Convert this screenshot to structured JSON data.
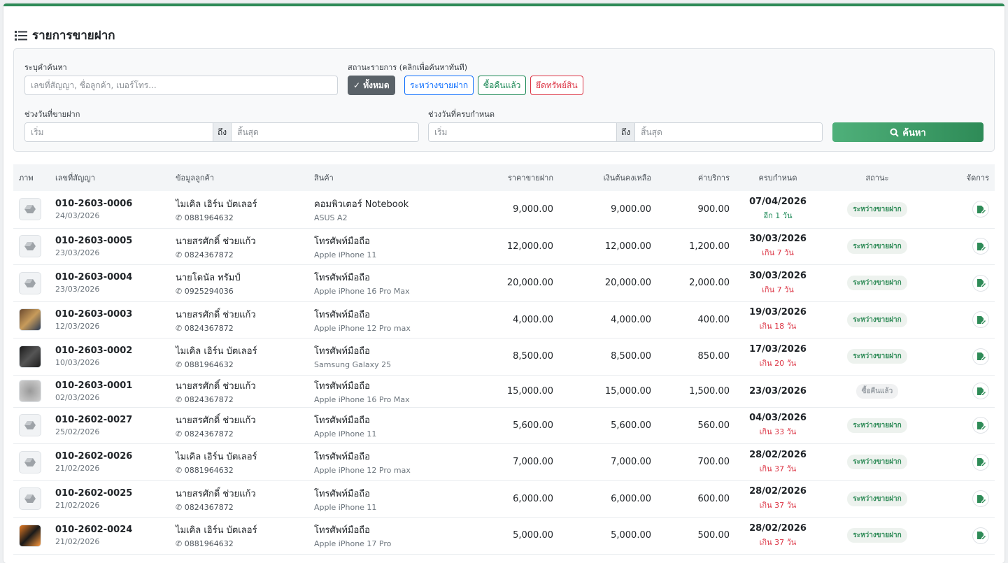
{
  "title": "รายการขายฝาก",
  "filters": {
    "keyword_label": "ระบุคำค้นหา",
    "keyword_placeholder": "เลขที่สัญญา, ชื่อลูกค้า, เบอร์โทร...",
    "status_label": "สถานะรายการ (คลิกเพื่อค้นหาทันที)",
    "status_buttons": [
      "ทั้งหมด",
      "ระหว่างขายฝาก",
      "ซื้อคืนแล้ว",
      "ยึดทรัพย์สิน"
    ],
    "sale_date_label": "ช่วงวันที่ขายฝาก",
    "due_date_label": "ช่วงวันที่ครบกำหนด",
    "start_placeholder": "เริ่ม",
    "to_label": "ถึง",
    "end_placeholder": "สิ้นสุด",
    "search_label": "ค้นหา"
  },
  "table": {
    "headers": [
      "ภาพ",
      "เลขที่สัญญา",
      "ข้อมูลลูกค้า",
      "สินค้า",
      "ราคาขายฝาก",
      "เงินต้นคงเหลือ",
      "ค่าบริการ",
      "ครบกำหนด",
      "สถานะ",
      "จัดการ"
    ],
    "rows": [
      {
        "thumb": "placeholder",
        "contract": "010-2603-0006",
        "date": "24/03/2026",
        "customer": "ไมเคิล เอิร์น บัตเลอร์",
        "phone": "0881964632",
        "product": "คอมพิวเตอร์ Notebook",
        "model": "ASUS A2",
        "price": "9,000.00",
        "principal": "9,000.00",
        "fee": "900.00",
        "due": "07/04/2026",
        "due_note": "อีก 1 วัน",
        "due_state": "ok",
        "status": "ระหว่างขายฝาก",
        "status_state": "pending"
      },
      {
        "thumb": "placeholder",
        "contract": "010-2603-0005",
        "date": "23/03/2026",
        "customer": "นายสรศักดิ์ ช่วยแก้ว",
        "phone": "0824367872",
        "product": "โทรศัพท์มือถือ",
        "model": "Apple iPhone 11",
        "price": "12,000.00",
        "principal": "12,000.00",
        "fee": "1,200.00",
        "due": "30/03/2026",
        "due_note": "เกิน 7 วัน",
        "due_state": "late",
        "status": "ระหว่างขายฝาก",
        "status_state": "pending"
      },
      {
        "thumb": "placeholder",
        "contract": "010-2603-0004",
        "date": "23/03/2026",
        "customer": "นายโดนัล ทรัมป์",
        "phone": "0925294036",
        "product": "โทรศัพท์มือถือ",
        "model": "Apple iPhone 16 Pro Max",
        "price": "20,000.00",
        "principal": "20,000.00",
        "fee": "2,000.00",
        "due": "30/03/2026",
        "due_note": "เกิน 7 วัน",
        "due_state": "late",
        "status": "ระหว่างขายฝาก",
        "status_state": "pending"
      },
      {
        "thumb": "photo1",
        "contract": "010-2603-0003",
        "date": "12/03/2026",
        "customer": "นายสรศักดิ์ ช่วยแก้ว",
        "phone": "0824367872",
        "product": "โทรศัพท์มือถือ",
        "model": "Apple iPhone 12 Pro max",
        "price": "4,000.00",
        "principal": "4,000.00",
        "fee": "400.00",
        "due": "19/03/2026",
        "due_note": "เกิน 18 วัน",
        "due_state": "late",
        "status": "ระหว่างขายฝาก",
        "status_state": "pending"
      },
      {
        "thumb": "photo2",
        "contract": "010-2603-0002",
        "date": "10/03/2026",
        "customer": "ไมเคิล เอิร์น บัตเลอร์",
        "phone": "0881964632",
        "product": "โทรศัพท์มือถือ",
        "model": "Samsung Galaxy 25",
        "price": "8,500.00",
        "principal": "8,500.00",
        "fee": "850.00",
        "due": "17/03/2026",
        "due_note": "เกิน 20 วัน",
        "due_state": "late",
        "status": "ระหว่างขายฝาก",
        "status_state": "pending"
      },
      {
        "thumb": "photo3",
        "contract": "010-2603-0001",
        "date": "02/03/2026",
        "customer": "นายสรศักดิ์ ช่วยแก้ว",
        "phone": "0824367872",
        "product": "โทรศัพท์มือถือ",
        "model": "Apple iPhone 16 Pro Max",
        "price": "15,000.00",
        "principal": "15,000.00",
        "fee": "1,500.00",
        "due": "23/03/2026",
        "due_note": "",
        "due_state": "none",
        "status": "ซื้อคืนแล้ว",
        "status_state": "done"
      },
      {
        "thumb": "placeholder",
        "contract": "010-2602-0027",
        "date": "25/02/2026",
        "customer": "นายสรศักดิ์ ช่วยแก้ว",
        "phone": "0824367872",
        "product": "โทรศัพท์มือถือ",
        "model": "Apple iPhone 11",
        "price": "5,600.00",
        "principal": "5,600.00",
        "fee": "560.00",
        "due": "04/03/2026",
        "due_note": "เกิน 33 วัน",
        "due_state": "late",
        "status": "ระหว่างขายฝาก",
        "status_state": "pending"
      },
      {
        "thumb": "placeholder",
        "contract": "010-2602-0026",
        "date": "21/02/2026",
        "customer": "ไมเคิล เอิร์น บัตเลอร์",
        "phone": "0881964632",
        "product": "โทรศัพท์มือถือ",
        "model": "Apple iPhone 12 Pro max",
        "price": "7,000.00",
        "principal": "7,000.00",
        "fee": "700.00",
        "due": "28/02/2026",
        "due_note": "เกิน 37 วัน",
        "due_state": "late",
        "status": "ระหว่างขายฝาก",
        "status_state": "pending"
      },
      {
        "thumb": "placeholder",
        "contract": "010-2602-0025",
        "date": "21/02/2026",
        "customer": "นายสรศักดิ์ ช่วยแก้ว",
        "phone": "0824367872",
        "product": "โทรศัพท์มือถือ",
        "model": "Apple iPhone 11",
        "price": "6,000.00",
        "principal": "6,000.00",
        "fee": "600.00",
        "due": "28/02/2026",
        "due_note": "เกิน 37 วัน",
        "due_state": "late",
        "status": "ระหว่างขายฝาก",
        "status_state": "pending"
      },
      {
        "thumb": "photo4",
        "contract": "010-2602-0024",
        "date": "21/02/2026",
        "customer": "ไมเคิล เอิร์น บัตเลอร์",
        "phone": "0881964632",
        "product": "โทรศัพท์มือถือ",
        "model": "Apple iPhone 17 Pro",
        "price": "5,000.00",
        "principal": "5,000.00",
        "fee": "500.00",
        "due": "28/02/2026",
        "due_note": "เกิน 37 วัน",
        "due_state": "late",
        "status": "ระหว่างขายฝาก",
        "status_state": "pending"
      }
    ]
  },
  "colors": {
    "accent": "#2e8b57",
    "late": "#dc3545",
    "ok": "#198754"
  }
}
